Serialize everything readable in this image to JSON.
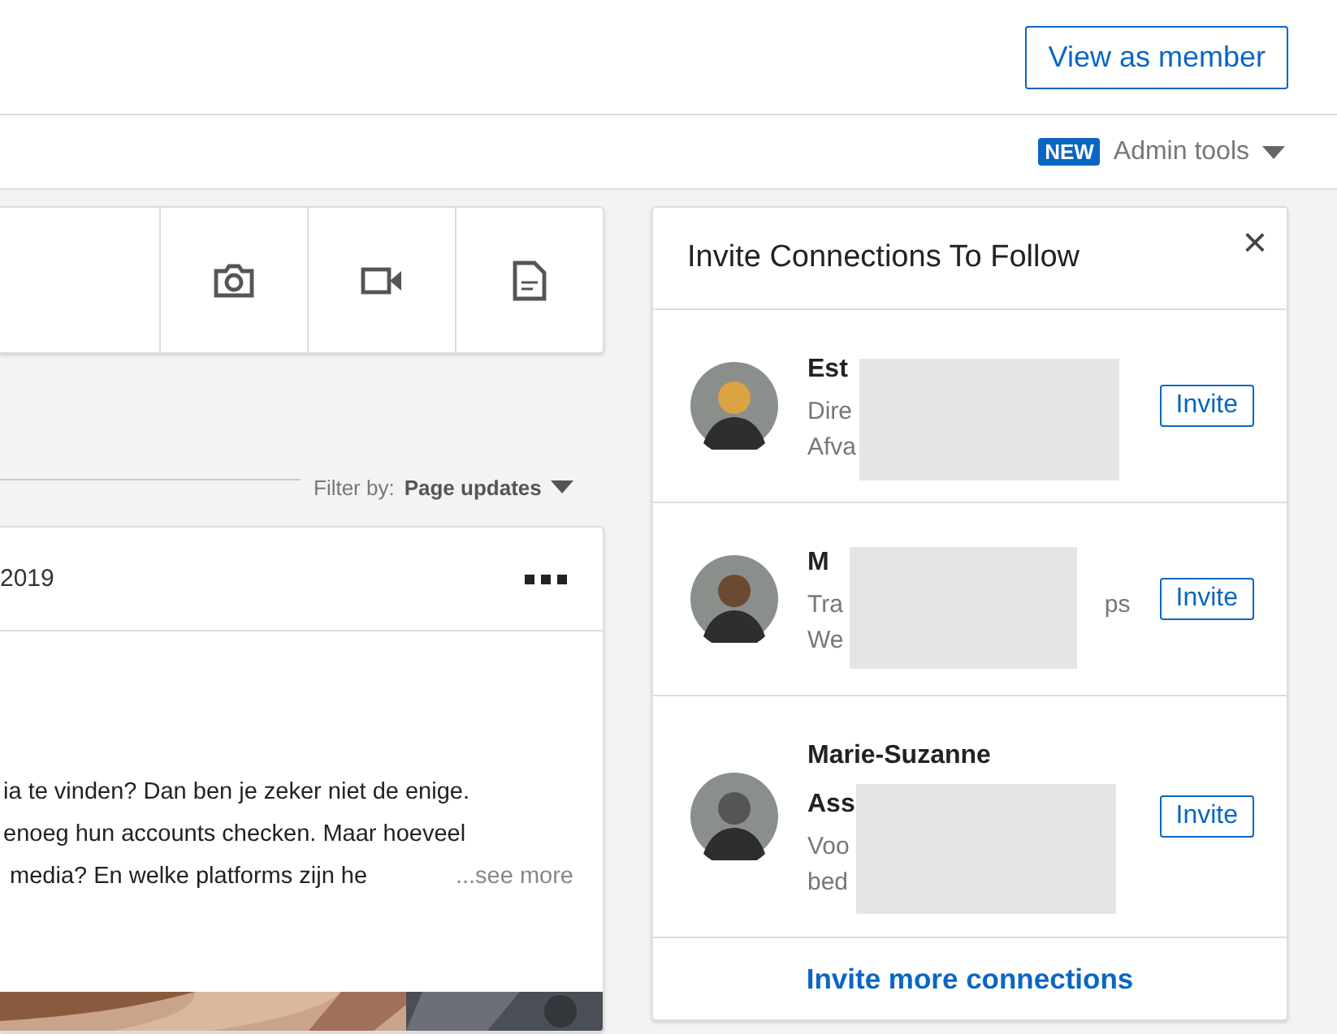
{
  "header": {
    "view_button": "View as member"
  },
  "admin_bar": {
    "badge": "NEW",
    "menu": "Admin tools"
  },
  "feed_filter": {
    "label": "Filter by:",
    "value": "Page updates"
  },
  "post": {
    "date": "2019",
    "lines": [
      "ia te vinden? Dan ben je zeker niet de enige.",
      "enoeg hun accounts checken. Maar hoeveel",
      " media? En welke platforms zijn he"
    ],
    "see_more": "...see more"
  },
  "invite_panel": {
    "title": "Invite Connections To Follow",
    "close": "×",
    "people": [
      {
        "name_lines": [
          "Est"
        ],
        "subtitle_lines": [
          "Dire",
          "Afva"
        ],
        "button": "Invite"
      },
      {
        "name_lines": [
          "M"
        ],
        "subtitle_lines": [
          "Tra",
          "We"
        ],
        "subtitle_tail": "ps",
        "button": "Invite"
      },
      {
        "name_lines": [
          "Marie-Suzanne",
          "Ass"
        ],
        "subtitle_lines": [
          "Voo",
          "bed"
        ],
        "button": "Invite"
      }
    ],
    "footer_link": "Invite more connections"
  }
}
